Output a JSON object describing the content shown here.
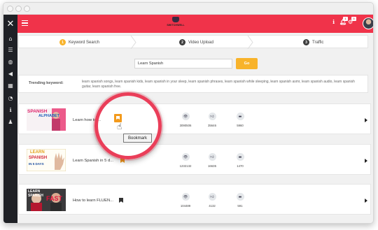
{
  "header": {
    "logo_text": "SWITCHWELL",
    "notif_badge_1": "1",
    "notif_badge_2": "3"
  },
  "sidebar": {
    "icons": [
      "home-icon",
      "list-icon",
      "globe-icon",
      "megaphone-icon",
      "film-icon",
      "chart-icon",
      "info-icon",
      "users-icon"
    ]
  },
  "steps": [
    {
      "num": "1",
      "label": "Keyword Search",
      "color": "#f8b32b"
    },
    {
      "num": "2",
      "label": "Video Upload",
      "color": "#3d3d3d"
    },
    {
      "num": "3",
      "label": "Traffic",
      "color": "#3d3d3d"
    }
  ],
  "search": {
    "value": "Learn Spanish",
    "button_label": "Go"
  },
  "trending": {
    "label": "Trending keyword:",
    "text": "learn spanish songs, learn spanish kids, learn spanish in your sleep, learn spanish phrases, learn spanish while sleeping, learn spanish asmr, learn spanish audio, learn spanish guitar, learn spanish free."
  },
  "results": [
    {
      "title": "Learn how to ...",
      "views": "3090506",
      "likes": "35646",
      "comments": "5960",
      "thumb_text": [
        "SPANISH",
        "ALPHABET"
      ],
      "bookmark_color": "#f39a1c"
    },
    {
      "title": "Learn Spanish in 5 d...",
      "views": "1232132",
      "likes": "16635",
      "comments": "1470",
      "thumb_text": [
        "LEARN",
        "SPANISH",
        "IN 5 DAYS"
      ],
      "bookmark_color": "#f39a1c"
    },
    {
      "title": "How to learn FLUEN...",
      "views": "104489",
      "likes": "4132",
      "comments": "591",
      "thumb_text": [
        "LEARN",
        "SPANISH",
        "FAST"
      ],
      "bookmark_color": "#333333"
    }
  ],
  "tooltip": {
    "text": "Bookmark"
  },
  "colors": {
    "accent": "#f0334a",
    "sidebar": "#1f2126",
    "button": "#f8b32b",
    "highlight_ring": "#ea3e59"
  }
}
